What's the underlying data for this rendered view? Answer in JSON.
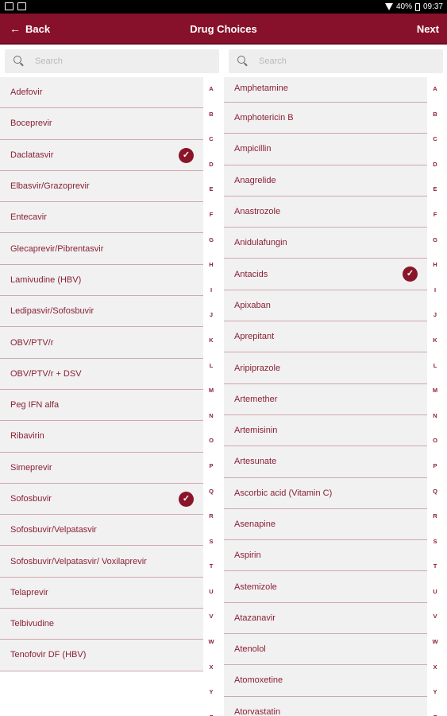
{
  "status_bar": {
    "battery": "40%",
    "time": "09:37"
  },
  "app_bar": {
    "back_label": "Back",
    "title": "Drug Choices",
    "next_label": "Next"
  },
  "accent_color": "#87112a",
  "left_panel": {
    "search_placeholder": "Search",
    "items": [
      {
        "label": "Adefovir",
        "checked": false
      },
      {
        "label": "Boceprevir",
        "checked": false
      },
      {
        "label": "Daclatasvir",
        "checked": true
      },
      {
        "label": "Elbasvir/Grazoprevir",
        "checked": false
      },
      {
        "label": "Entecavir",
        "checked": false
      },
      {
        "label": "Glecaprevir/Pibrentasvir",
        "checked": false
      },
      {
        "label": "Lamivudine (HBV)",
        "checked": false
      },
      {
        "label": "Ledipasvir/Sofosbuvir",
        "checked": false
      },
      {
        "label": "OBV/PTV/r",
        "checked": false
      },
      {
        "label": "OBV/PTV/r + DSV",
        "checked": false
      },
      {
        "label": "Peg IFN alfa",
        "checked": false
      },
      {
        "label": "Ribavirin",
        "checked": false
      },
      {
        "label": "Simeprevir",
        "checked": false
      },
      {
        "label": "Sofosbuvir",
        "checked": true
      },
      {
        "label": "Sofosbuvir/Velpatasvir",
        "checked": false
      },
      {
        "label": "Sofosbuvir/Velpatasvir/ Voxilaprevir",
        "checked": false
      },
      {
        "label": "Telaprevir",
        "checked": false
      },
      {
        "label": "Telbivudine",
        "checked": false
      },
      {
        "label": "Tenofovir DF (HBV)",
        "checked": false
      }
    ]
  },
  "right_panel": {
    "search_placeholder": "Search",
    "items": [
      {
        "label": "Amphetamine",
        "checked": false
      },
      {
        "label": "Amphotericin B",
        "checked": false
      },
      {
        "label": "Ampicillin",
        "checked": false
      },
      {
        "label": "Anagrelide",
        "checked": false
      },
      {
        "label": "Anastrozole",
        "checked": false
      },
      {
        "label": "Anidulafungin",
        "checked": false
      },
      {
        "label": "Antacids",
        "checked": true
      },
      {
        "label": "Apixaban",
        "checked": false
      },
      {
        "label": "Aprepitant",
        "checked": false
      },
      {
        "label": "Aripiprazole",
        "checked": false
      },
      {
        "label": "Artemether",
        "checked": false
      },
      {
        "label": "Artemisinin",
        "checked": false
      },
      {
        "label": "Artesunate",
        "checked": false
      },
      {
        "label": "Ascorbic acid (Vitamin C)",
        "checked": false
      },
      {
        "label": "Asenapine",
        "checked": false
      },
      {
        "label": "Aspirin",
        "checked": false
      },
      {
        "label": "Astemizole",
        "checked": false
      },
      {
        "label": "Atazanavir",
        "checked": false
      },
      {
        "label": "Atenolol",
        "checked": false
      },
      {
        "label": "Atomoxetine",
        "checked": false
      },
      {
        "label": "Atorvastatin",
        "checked": false
      }
    ]
  },
  "alphabet": [
    "A",
    "B",
    "C",
    "D",
    "E",
    "F",
    "G",
    "H",
    "I",
    "J",
    "K",
    "L",
    "M",
    "N",
    "O",
    "P",
    "Q",
    "R",
    "S",
    "T",
    "U",
    "V",
    "W",
    "X",
    "Y",
    "Z"
  ]
}
